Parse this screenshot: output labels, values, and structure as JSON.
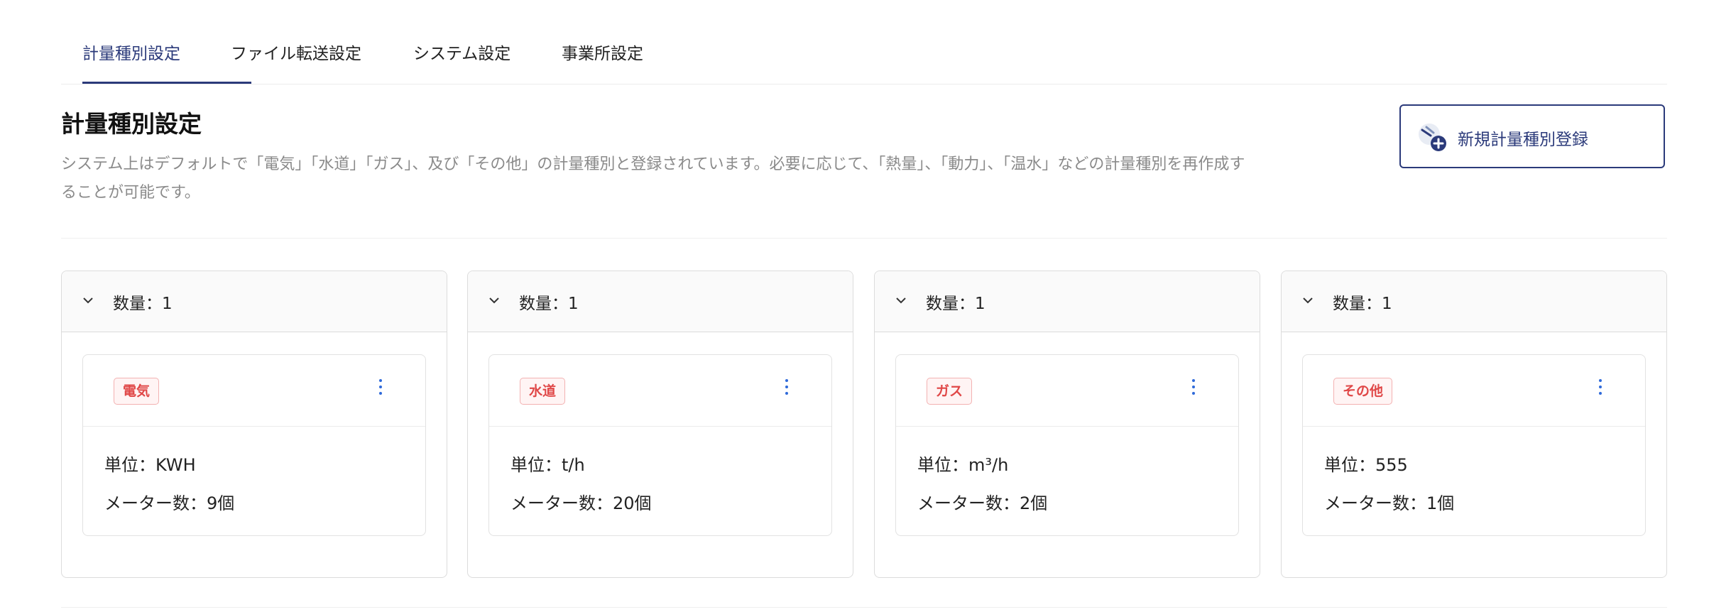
{
  "tabs": [
    {
      "label": "計量種別設定",
      "active": true
    },
    {
      "label": "ファイル転送設定",
      "active": false
    },
    {
      "label": "システム設定",
      "active": false
    },
    {
      "label": "事業所設定",
      "active": false
    }
  ],
  "section": {
    "title": "計量種別設定",
    "description": "システム上はデフォルトで「電気」「水道」「ガス」、及び「その他」の計量種別と登録されています。必要に応じて、「熱量」、「動力」、「温水」などの計量種別を再作成することが可能です。"
  },
  "new_button": {
    "label": "新規計量種別登録",
    "icon": "meter-add-icon"
  },
  "groups": [
    {
      "count_label": "数量：1",
      "tag": "電気",
      "unit": "単位：KWH",
      "meters": "メーター数：9個"
    },
    {
      "count_label": "数量：1",
      "tag": "水道",
      "unit": "単位：t/h",
      "meters": "メーター数：20個"
    },
    {
      "count_label": "数量：1",
      "tag": "ガス",
      "unit": "単位：m³/h",
      "meters": "メーター数：2個"
    },
    {
      "count_label": "数量：1",
      "tag": "その他",
      "unit": "単位：555",
      "meters": "メーター数：1個"
    }
  ],
  "colors": {
    "accent": "#2b3a7a",
    "tag_text": "#e04848",
    "tag_border": "#f3b2b2",
    "tag_bg": "#fff4f4",
    "kebab": "#2f6ad9"
  }
}
